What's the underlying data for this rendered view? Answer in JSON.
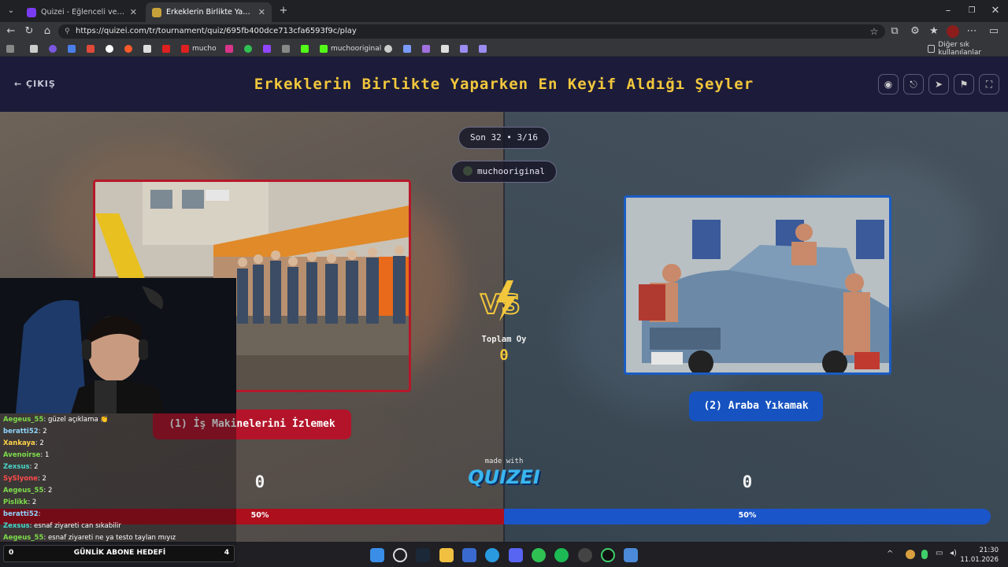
{
  "browser": {
    "tabs": [
      {
        "title": "Quizei - Eğlenceli ve etkileşimli qu",
        "active": false
      },
      {
        "title": "Erkeklerin Birlikte Yaparken En Keyi",
        "active": true
      }
    ],
    "url": "https://quizei.com/tr/tournament/quiz/695fb400dce713cfa6593f9c/play",
    "bookmarks": [
      "mucho",
      "muchooriginal",
      "Diğer sık kullanılanlar"
    ]
  },
  "header": {
    "exit_label": "ÇIKIŞ",
    "title": "Erkeklerin Birlikte Yaparken En Keyif Aldığı Şeyler",
    "buttons": [
      "eye-icon",
      "share-icon",
      "send-icon",
      "flag-icon",
      "fullscreen-icon"
    ]
  },
  "match": {
    "round_label": "Son 32 • 3/16",
    "user": "muchooriginal",
    "vs_label": "VS",
    "total_votes_label": "Toplam Oy",
    "total_votes": "0",
    "made_with": "made with",
    "brand": "QUIZEI",
    "left": {
      "label": "(1) İş Makinelerini İzlemek",
      "score": "0",
      "percent": "50%",
      "color": "#b3142a"
    },
    "right": {
      "label": "(2) Araba Yıkamak",
      "score": "0",
      "percent": "50%",
      "color": "#1653c0"
    }
  },
  "chat": [
    {
      "user": "Aegeus_55",
      "msg": ": güzel açıklama 👏",
      "color": "#7ddc4a"
    },
    {
      "user": "beratti52",
      "msg": ": 2",
      "color": "#8fd6ff"
    },
    {
      "user": "Xankaya",
      "msg": ": 2",
      "color": "#ffd24a"
    },
    {
      "user": "Avenoirse",
      "msg": ": 1",
      "color": "#7ddc4a"
    },
    {
      "user": "Zexsus",
      "msg": ": 2",
      "color": "#4ad6c8"
    },
    {
      "user": "SySlyone",
      "msg": ": 2",
      "color": "#ff4a4a"
    },
    {
      "user": "Aegeus_55",
      "msg": ": 2",
      "color": "#7ddc4a"
    },
    {
      "user": "Pislikk",
      "msg": ": 2",
      "color": "#7ddc4a"
    },
    {
      "user": "beratti52",
      "msg": ":",
      "color": "#8fd6ff"
    },
    {
      "user": "Zexsus",
      "msg": ": esnaf ziyareti can sıkabilir",
      "color": "#4ad6c8"
    },
    {
      "user": "Aegeus_55",
      "msg": ": esnaf ziyareti ne ya testo taylan mıyız",
      "color": "#7ddc4a"
    }
  ],
  "goal": {
    "current": "0",
    "label": "GÜNLİK ABONE HEDEFİ",
    "target": "4"
  },
  "taskbar": {
    "time": "21:30",
    "date": "11.01.2026"
  }
}
